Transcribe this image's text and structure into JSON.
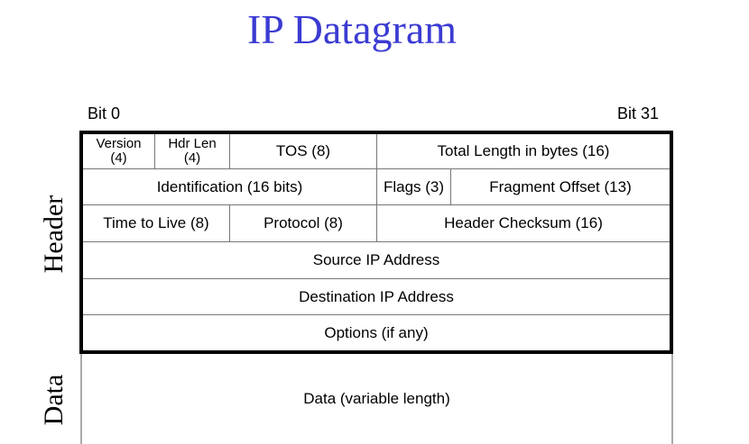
{
  "title": "IP Datagram",
  "bits": {
    "start": "Bit 0",
    "end": "Bit 31"
  },
  "sections": {
    "header": "Header",
    "data": "Data"
  },
  "fields": {
    "version": "Version (4)",
    "hdr_len": "Hdr Len (4)",
    "tos": "TOS (8)",
    "total_length": "Total Length in bytes (16)",
    "identification": "Identification (16 bits)",
    "flags": "Flags (3)",
    "fragment_offset": "Fragment Offset (13)",
    "ttl": "Time to Live (8)",
    "protocol": "Protocol (8)",
    "header_checksum": "Header Checksum (16)",
    "source_ip": "Source IP Address",
    "destination_ip": "Destination IP Address",
    "options": "Options (if any)",
    "data": "Data (variable length)"
  }
}
